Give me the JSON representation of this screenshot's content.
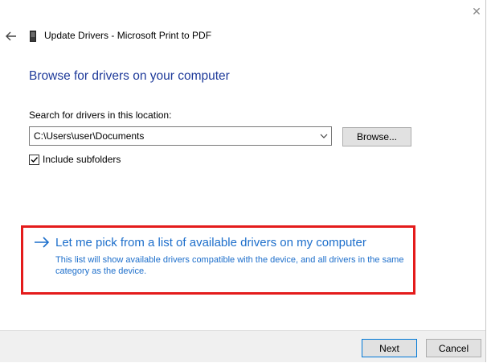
{
  "window": {
    "title": "Update Drivers - Microsoft Print to PDF",
    "close_icon": "close-icon",
    "back_icon": "back-arrow-icon",
    "device_icon": "printer-device-icon"
  },
  "main": {
    "heading": "Browse for drivers on your computer",
    "search_label": "Search for drivers in this location:",
    "path_value": "C:\\Users\\user\\Documents",
    "browse_label": "Browse...",
    "include_subfolders": {
      "label": "Include subfolders",
      "checked": true
    }
  },
  "pick_option": {
    "arrow_icon": "right-arrow-icon",
    "title": "Let me pick from a list of available drivers on my computer",
    "description": "This list will show available drivers compatible with the device, and all drivers in the same category as the device.",
    "link_color": "#1c6ecb",
    "highlight_color": "#e41b1b"
  },
  "footer": {
    "next_label": "Next",
    "cancel_label": "Cancel"
  }
}
